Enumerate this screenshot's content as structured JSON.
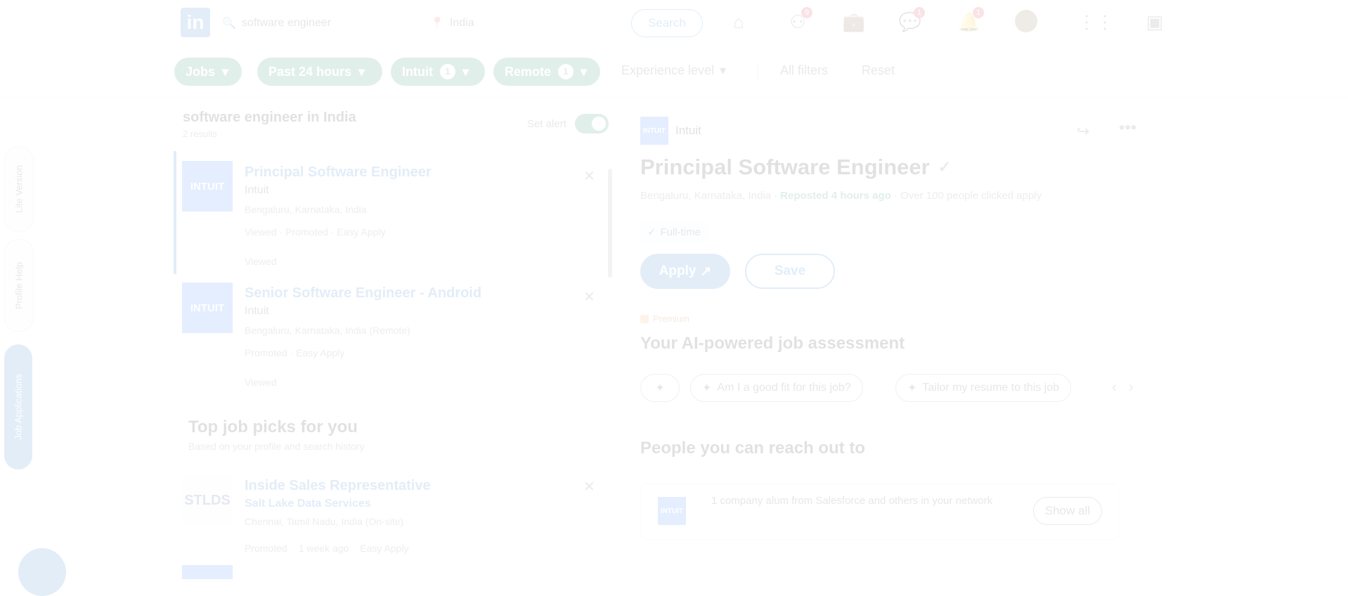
{
  "topbar": {
    "logo": "in",
    "search_query": "software engineer",
    "location": "India",
    "search_button": "Search",
    "badges": {
      "network": "9",
      "notifications": "1",
      "messaging": "1"
    }
  },
  "filters": {
    "jobs": "Jobs",
    "past24": "Past 24 hours",
    "company": "Intuit",
    "company_count": "1",
    "remote": "Remote",
    "remote_count": "1",
    "experience": "Experience level",
    "all_filters": "All filters",
    "reset": "Reset"
  },
  "list": {
    "title": "software engineer in India",
    "count": "2 results",
    "set_alert": "Set alert",
    "jobs": [
      {
        "title": "Principal Software Engineer",
        "company": "Intuit",
        "location": "Bengaluru, Karnataka, India",
        "meta": "Viewed · Promoted · Easy Apply",
        "status": "Viewed",
        "logo": "INTUIT"
      },
      {
        "title": "Senior Software Engineer - Android",
        "company": "Intuit",
        "location": "Bengaluru, Karnataka, India (Remote)",
        "meta": "Promoted · Easy Apply",
        "status": "Viewed",
        "logo": "INTUIT"
      }
    ],
    "top_picks_title": "Top job picks for you",
    "top_picks_sub": "Based on your profile and search history",
    "pick": {
      "title": "Inside Sales Representative",
      "company": "Salt Lake Data Services",
      "location": "Chennai, Tamil Nadu, India (On-site)",
      "meta1": "Promoted",
      "meta2": "1 week ago",
      "meta3": "Easy Apply",
      "logo": "STLDS"
    }
  },
  "detail": {
    "company": "Intuit",
    "title": "Principal Software Engineer",
    "meta_prefix": "Bengaluru, Karnataka, India ·",
    "meta_reposted": "Reposted 4 hours ago",
    "meta_suffix": "· Over 100 people clicked apply",
    "pill": "Full-time",
    "apply": "Apply",
    "save": "Save",
    "premium": "Premium",
    "ai_title": "Your AI-powered job assessment",
    "ai_chip1": "Am I a good fit for this job?",
    "ai_chip2": "Tailor my resume to this job",
    "reach_title": "People you can reach out to",
    "reach_text": "1 company alum from Salesforce and others in your network",
    "show_all": "Show all"
  },
  "side": {
    "tab1": "Lite Version",
    "tab2": "Profile Help",
    "tab3": "Job Applications"
  },
  "colors": {
    "brand": "#0a66c2",
    "chip_green": "#01754f",
    "intuit_blue": "#236cff"
  }
}
